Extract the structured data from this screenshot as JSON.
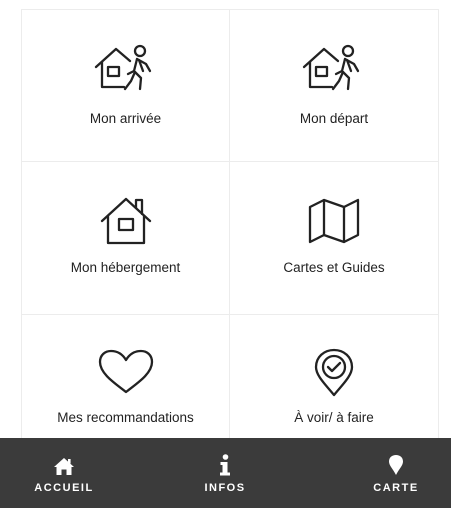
{
  "tiles": [
    {
      "label": "Mon arrivée",
      "icon": "house-walking-person-icon"
    },
    {
      "label": "Mon départ",
      "icon": "house-walking-person-icon"
    },
    {
      "label": "Mon hébergement",
      "icon": "house-icon"
    },
    {
      "label": "Cartes et Guides",
      "icon": "folded-map-icon"
    },
    {
      "label": "Mes recommandations",
      "icon": "heart-icon"
    },
    {
      "label": "À voir/ à faire",
      "icon": "map-pin-check-icon"
    }
  ],
  "nav": {
    "accueil": "ACCUEIL",
    "infos": "INFOS",
    "carte": "CARTE"
  },
  "colors": {
    "nav_background": "#3b3b3b",
    "icon_stroke": "#222222",
    "tile_border": "#ececec"
  }
}
